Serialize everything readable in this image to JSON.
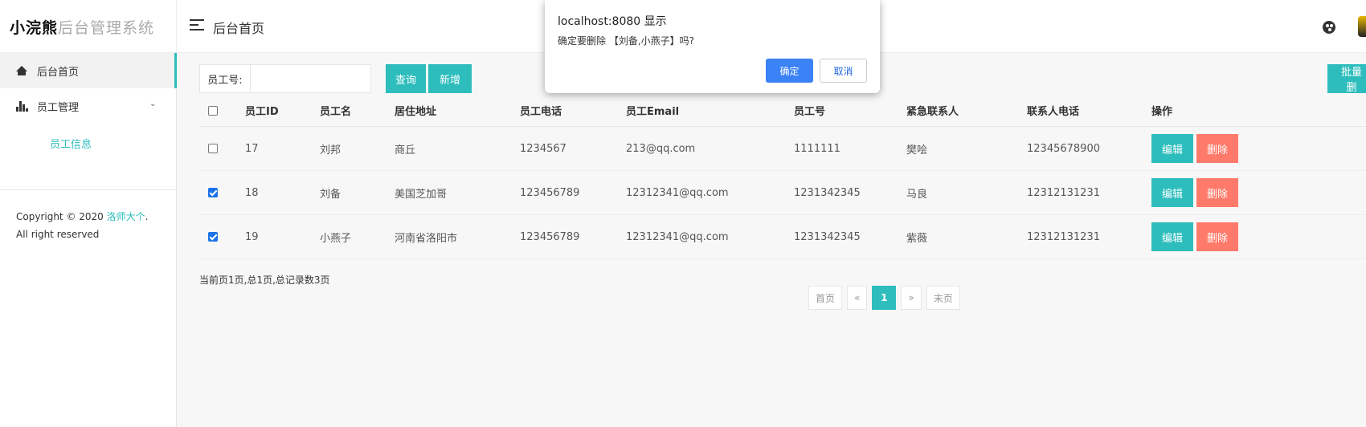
{
  "header": {
    "brand": "小浣熊",
    "system_name": "后台管理系统",
    "title": "后台首页"
  },
  "sidebar": {
    "items": [
      {
        "label": "后台首页",
        "icon": "home-icon"
      },
      {
        "label": "员工管理",
        "icon": "chart-icon"
      }
    ],
    "subitems": [
      {
        "label": "员工信息"
      }
    ],
    "copyright_prefix": "Copyright © 2020 ",
    "copyright_link": "洛师大个",
    "copyright_suffix": ". All right reserved"
  },
  "search": {
    "label": "员工号:",
    "value": "",
    "query_label": "查询",
    "add_label": "新增",
    "batch_label": "批量删"
  },
  "table": {
    "headers": [
      "员工ID",
      "员工名",
      "居住地址",
      "员工电话",
      "员工Email",
      "员工号",
      "紧急联系人",
      "联系人电话",
      "操作"
    ],
    "rows": [
      {
        "checked": false,
        "id": "17",
        "name": "刘邦",
        "address": "商丘",
        "phone": "1234567",
        "email": "213@qq.com",
        "emp_no": "1111111",
        "contact": "樊哙",
        "contact_phone": "12345678900"
      },
      {
        "checked": true,
        "id": "18",
        "name": "刘备",
        "address": "美国芝加哥",
        "phone": "123456789",
        "email": "12312341@qq.com",
        "emp_no": "1231342345",
        "contact": "马良",
        "contact_phone": "12312131231"
      },
      {
        "checked": true,
        "id": "19",
        "name": "小燕子",
        "address": "河南省洛阳市",
        "phone": "123456789",
        "email": "12312341@qq.com",
        "emp_no": "1231342345",
        "contact": "紫薇",
        "contact_phone": "12312131231"
      }
    ],
    "edit_label": "编辑",
    "delete_label": "删除"
  },
  "pagination": {
    "info": "当前页1页,总1页,总记录数3页",
    "first": "首页",
    "prev": "«",
    "current": "1",
    "next": "»",
    "last": "末页"
  },
  "dialog": {
    "title": "localhost:8080 显示",
    "message": "确定要删除 【刘备,小燕子】吗?",
    "ok_label": "确定",
    "cancel_label": "取消"
  },
  "colors": {
    "accent": "#2ebdbd",
    "danger": "#ff7a6a",
    "dialog_primary": "#3b82f6"
  }
}
